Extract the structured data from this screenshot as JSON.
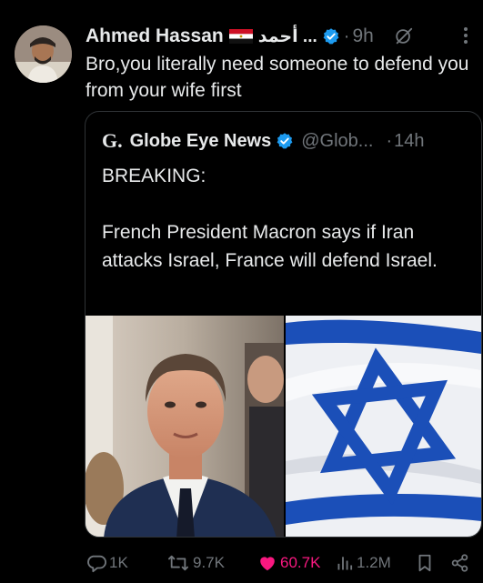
{
  "tweet": {
    "author_name": "Ahmed Hassan",
    "author_name_ar": "أحمد ...",
    "dot": "·",
    "time": "9h",
    "text": "Bro,you literally need someone to defend you from your wife first",
    "avatar_icon": "profile-photo"
  },
  "quote": {
    "logo": "G.",
    "name": "Globe Eye News",
    "handle": "@Glob...",
    "dot": "·",
    "time": "14h",
    "text": "BREAKING:\n\nFrench President Macron says if Iran attacks Israel, France will defend Israel.",
    "media": [
      "photo-of-man-in-suit",
      "israeli-flag"
    ]
  },
  "actions": {
    "replies": "1K",
    "reposts": "9.7K",
    "likes": "60.7K",
    "views": "1.2M"
  },
  "colors": {
    "background": "#000000",
    "text": "#e7e9ea",
    "muted": "#71767b",
    "verified": "#1d9bf0",
    "like": "#f91880",
    "border": "#2f3336",
    "flag_blue": "#1b4fb8"
  }
}
